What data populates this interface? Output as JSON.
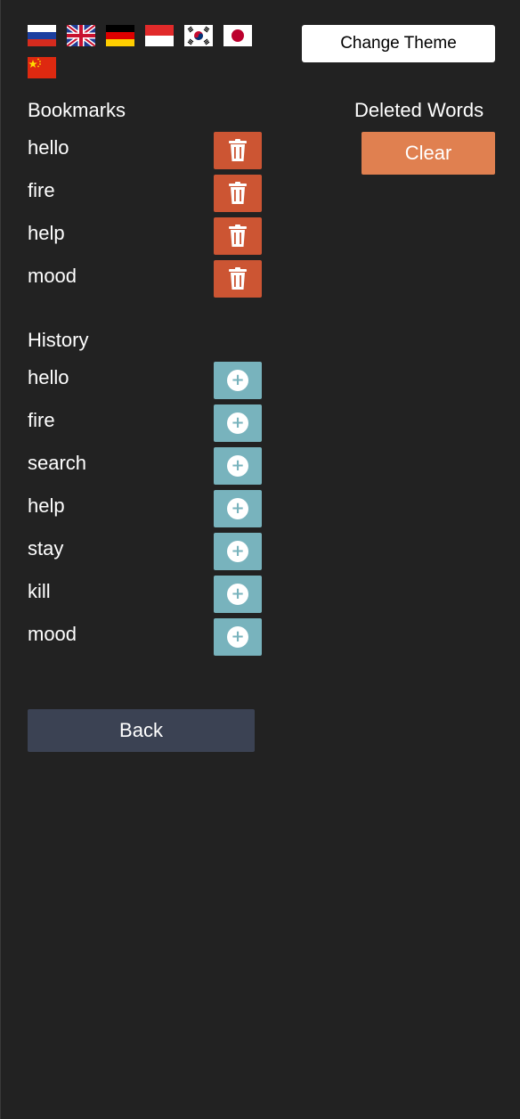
{
  "flags": [
    {
      "name": "russia"
    },
    {
      "name": "united-kingdom"
    },
    {
      "name": "germany"
    },
    {
      "name": "indonesia"
    },
    {
      "name": "south-korea"
    },
    {
      "name": "japan"
    },
    {
      "name": "china"
    }
  ],
  "header": {
    "theme_button_label": "Change Theme"
  },
  "bookmarks": {
    "title": "Bookmarks",
    "items": [
      "hello",
      "fire",
      "help",
      "mood"
    ],
    "action_icon": "trash-icon"
  },
  "deleted": {
    "title": "Deleted Words",
    "clear_label": "Clear"
  },
  "history": {
    "title": "History",
    "items": [
      "hello",
      "fire",
      "search",
      "help",
      "stay",
      "kill",
      "mood"
    ],
    "action_icon": "plus-circle-icon",
    "action_symbol": "+"
  },
  "footer": {
    "back_label": "Back"
  },
  "colors": {
    "background": "#222222",
    "delete": "#cc5533",
    "add": "#78b3bd",
    "clear": "#e08050",
    "back": "#3b4253",
    "theme_button": "#ffffff"
  }
}
